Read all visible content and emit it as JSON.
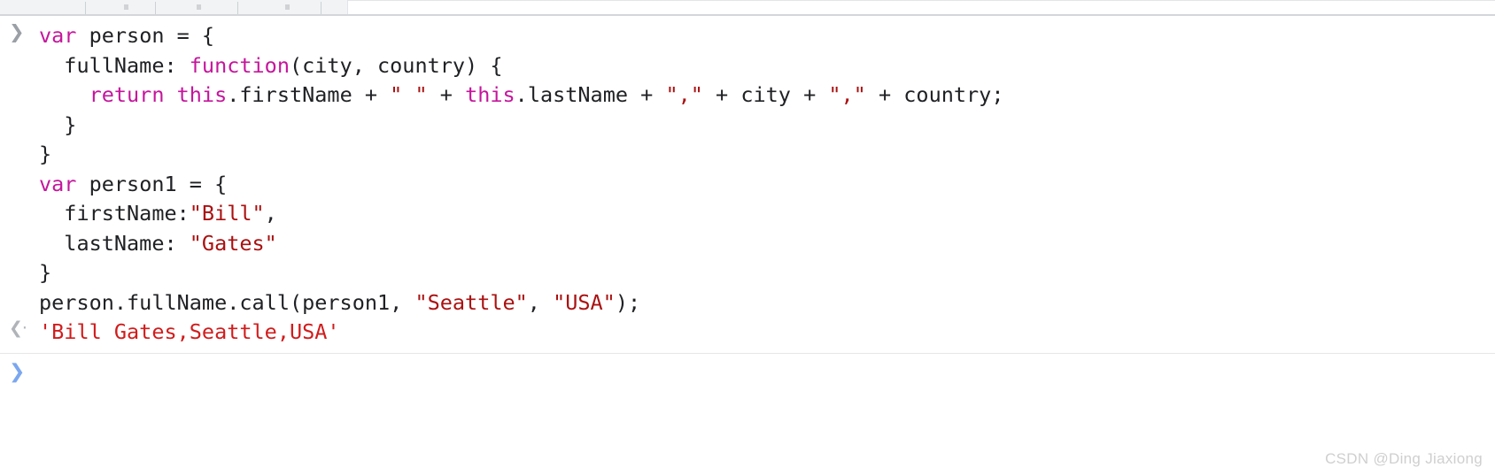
{
  "toolbar": {
    "filter_placeholder": ""
  },
  "console": {
    "input_prompt_icon": "chevron-right-icon",
    "output_prompt_icon": "chevron-left-icon",
    "new_prompt_icon": "chevron-right-icon",
    "input_lines": [
      [
        {
          "t": "var",
          "c": "kw"
        },
        {
          "t": " person = {",
          "c": "plain"
        }
      ],
      [
        {
          "t": "  fullName: ",
          "c": "plain"
        },
        {
          "t": "function",
          "c": "kw"
        },
        {
          "t": "(city, country) {",
          "c": "plain"
        }
      ],
      [
        {
          "t": "    ",
          "c": "plain"
        },
        {
          "t": "return",
          "c": "kw"
        },
        {
          "t": " ",
          "c": "plain"
        },
        {
          "t": "this",
          "c": "kw"
        },
        {
          "t": ".firstName + ",
          "c": "plain"
        },
        {
          "t": "\" \"",
          "c": "str"
        },
        {
          "t": " + ",
          "c": "plain"
        },
        {
          "t": "this",
          "c": "kw"
        },
        {
          "t": ".lastName + ",
          "c": "plain"
        },
        {
          "t": "\",\"",
          "c": "str"
        },
        {
          "t": " + city + ",
          "c": "plain"
        },
        {
          "t": "\",\"",
          "c": "str"
        },
        {
          "t": " + country;",
          "c": "plain"
        }
      ],
      [
        {
          "t": "  }",
          "c": "plain"
        }
      ],
      [
        {
          "t": "}",
          "c": "plain"
        }
      ],
      [
        {
          "t": "var",
          "c": "kw"
        },
        {
          "t": " person1 = {",
          "c": "plain"
        }
      ],
      [
        {
          "t": "  firstName:",
          "c": "plain"
        },
        {
          "t": "\"Bill\"",
          "c": "str"
        },
        {
          "t": ",",
          "c": "plain"
        }
      ],
      [
        {
          "t": "  lastName: ",
          "c": "plain"
        },
        {
          "t": "\"Gates\"",
          "c": "str"
        }
      ],
      [
        {
          "t": "}",
          "c": "plain"
        }
      ],
      [
        {
          "t": "person.fullName.call(person1, ",
          "c": "plain"
        },
        {
          "t": "\"Seattle\"",
          "c": "str"
        },
        {
          "t": ", ",
          "c": "plain"
        },
        {
          "t": "\"USA\"",
          "c": "str"
        },
        {
          "t": ");",
          "c": "plain"
        }
      ]
    ],
    "output_value": "'Bill Gates,Seattle,USA'",
    "new_prompt_value": ""
  },
  "watermark": {
    "text": "CSDN @Ding Jiaxiong"
  },
  "colors": {
    "keyword": "#c5169c",
    "string": "#aa1111",
    "plain": "#202124",
    "output": "#d11c1c",
    "prompt_blue": "#7ba7ef",
    "toolbar_bg": "#f1f3f4"
  }
}
